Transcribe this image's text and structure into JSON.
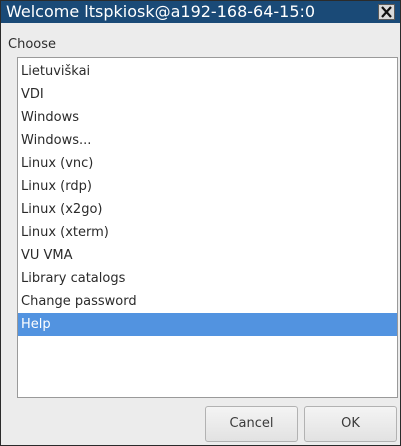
{
  "window": {
    "title": "Welcome ltspkiosk@a192-168-64-15:0",
    "close_icon": "close-x-icon"
  },
  "dialog": {
    "prompt": "Choose",
    "items": [
      {
        "label": "Lietuviškai"
      },
      {
        "label": "VDI"
      },
      {
        "label": "Windows"
      },
      {
        "label": "Windows..."
      },
      {
        "label": "Linux (vnc)"
      },
      {
        "label": "Linux (rdp)"
      },
      {
        "label": "Linux (x2go)"
      },
      {
        "label": "Linux (xterm)"
      },
      {
        "label": "VU VMA"
      },
      {
        "label": "Library catalogs"
      },
      {
        "label": "Change password"
      },
      {
        "label": "Help"
      }
    ],
    "selected_label": "Help"
  },
  "buttons": {
    "cancel_label": "Cancel",
    "ok_label": "OK"
  },
  "colors": {
    "titlebar": "#1a4a77",
    "selection": "#5293e0"
  }
}
